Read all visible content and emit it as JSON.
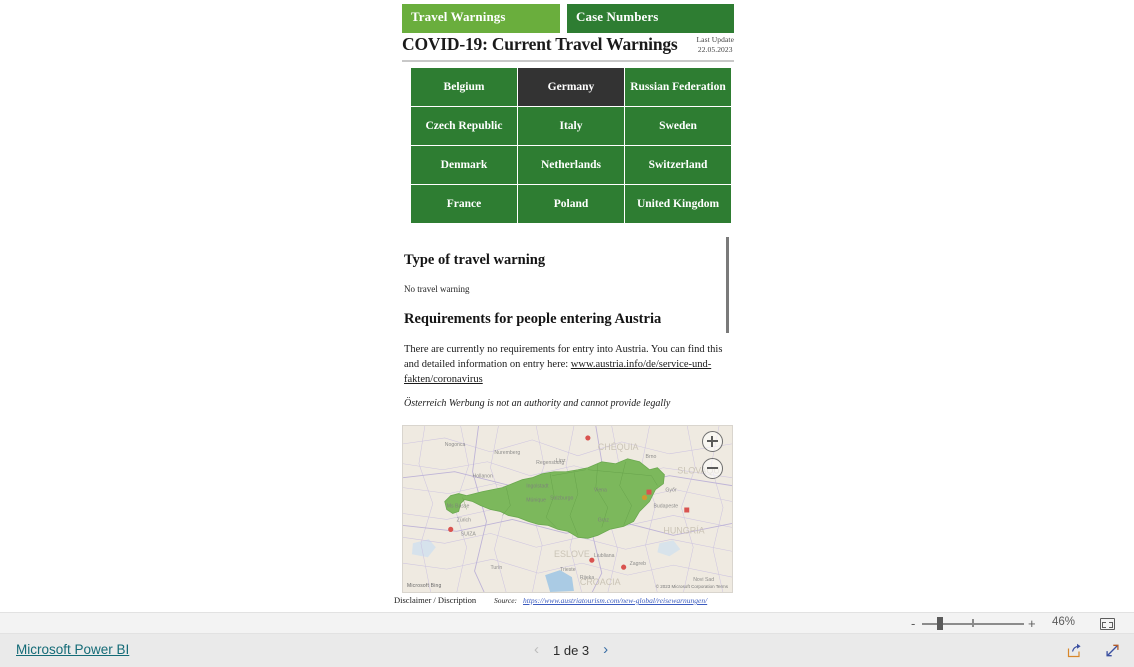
{
  "report": {
    "tabs": [
      {
        "label": "Travel Warnings",
        "color": "#6aae3d",
        "active": true
      },
      {
        "label": "Case Numbers",
        "color": "#2e7d32",
        "active": false
      }
    ],
    "title": "COVID-19: Current Travel Warnings",
    "last_update": {
      "label": "Last Update",
      "date": "22.05.2023"
    },
    "countries": [
      {
        "name": "Belgium",
        "selected": false
      },
      {
        "name": "Germany",
        "selected": true
      },
      {
        "name": "Russian Federation",
        "selected": false
      },
      {
        "name": "Czech Republic",
        "selected": false
      },
      {
        "name": "Italy",
        "selected": false
      },
      {
        "name": "Sweden",
        "selected": false
      },
      {
        "name": "Denmark",
        "selected": false
      },
      {
        "name": "Netherlands",
        "selected": false
      },
      {
        "name": "Switzerland",
        "selected": false
      },
      {
        "name": "France",
        "selected": false
      },
      {
        "name": "Poland",
        "selected": false
      },
      {
        "name": "United Kingdom",
        "selected": false
      }
    ],
    "detail": {
      "warning_heading": "Type of travel warning",
      "warning_value": "No travel warning",
      "requirements_heading": "Requirements for people entering Austria",
      "requirements_text_before": "There are currently no requirements for entry into Austria. You can find this and detailed information on entry here: ",
      "requirements_link": "www.austria.info/de/service-und-fakten/coronavirus",
      "legal_note": "Österreich Werbung is not an authority and cannot provide legally"
    },
    "map": {
      "highlighted_country": "Austria",
      "highlight_color": "#7cb85c",
      "zoom_in_label": "+",
      "zoom_out_label": "−",
      "logo": "Microsoft Bing",
      "attribution": "© 2023 Microsoft Corporation  Terms"
    },
    "source": {
      "disclaimer_label": "Disclaimer / Discription",
      "source_prefix": "Source:",
      "source_url": "https://www.austriatourism.com/new-global/reisewarnungen/"
    }
  },
  "zoom_toolbar": {
    "minus": "-",
    "plus": "+",
    "level": "46%"
  },
  "status_bar": {
    "brand": "Microsoft Power BI",
    "page_indicator": "1 de 3",
    "prev": "‹",
    "next": "›"
  }
}
